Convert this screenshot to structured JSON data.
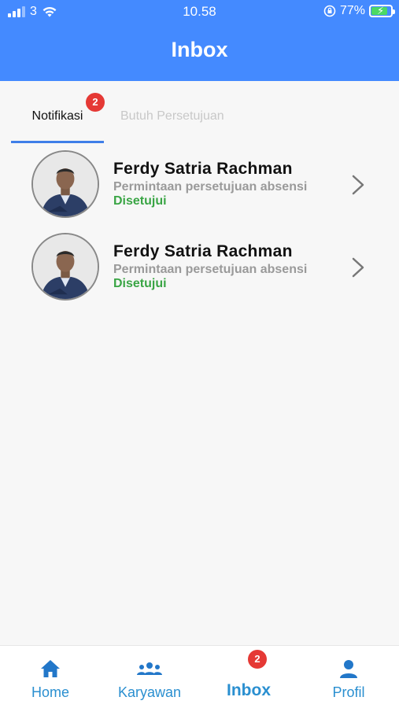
{
  "status_bar": {
    "carrier": "3",
    "time": "10.58",
    "battery": "77%"
  },
  "header": {
    "title": "Inbox"
  },
  "tabs": [
    {
      "label": "Notifikasi",
      "badge": "2",
      "active": true
    },
    {
      "label": "Butuh Persetujuan",
      "active": false
    }
  ],
  "notifications": [
    {
      "name": "Ferdy Satria Rachman",
      "description": "Permintaan persetujuan absensi",
      "status": "Disetujui"
    },
    {
      "name": "Ferdy Satria Rachman",
      "description": "Permintaan persetujuan absensi",
      "status": "Disetujui"
    }
  ],
  "bottom_nav": {
    "items": [
      {
        "label": "Home",
        "icon": "home-icon"
      },
      {
        "label": "Karyawan",
        "icon": "people-icon"
      },
      {
        "label": "Inbox",
        "icon": "inbox-icon",
        "badge": "2",
        "active": true
      },
      {
        "label": "Profil",
        "icon": "person-icon"
      }
    ]
  },
  "colors": {
    "header": "#448aff",
    "tab_indicator": "#3f7fe8",
    "badge": "#e53935",
    "status_approved": "#3aa545",
    "nav_accent": "#2a8fd0"
  }
}
